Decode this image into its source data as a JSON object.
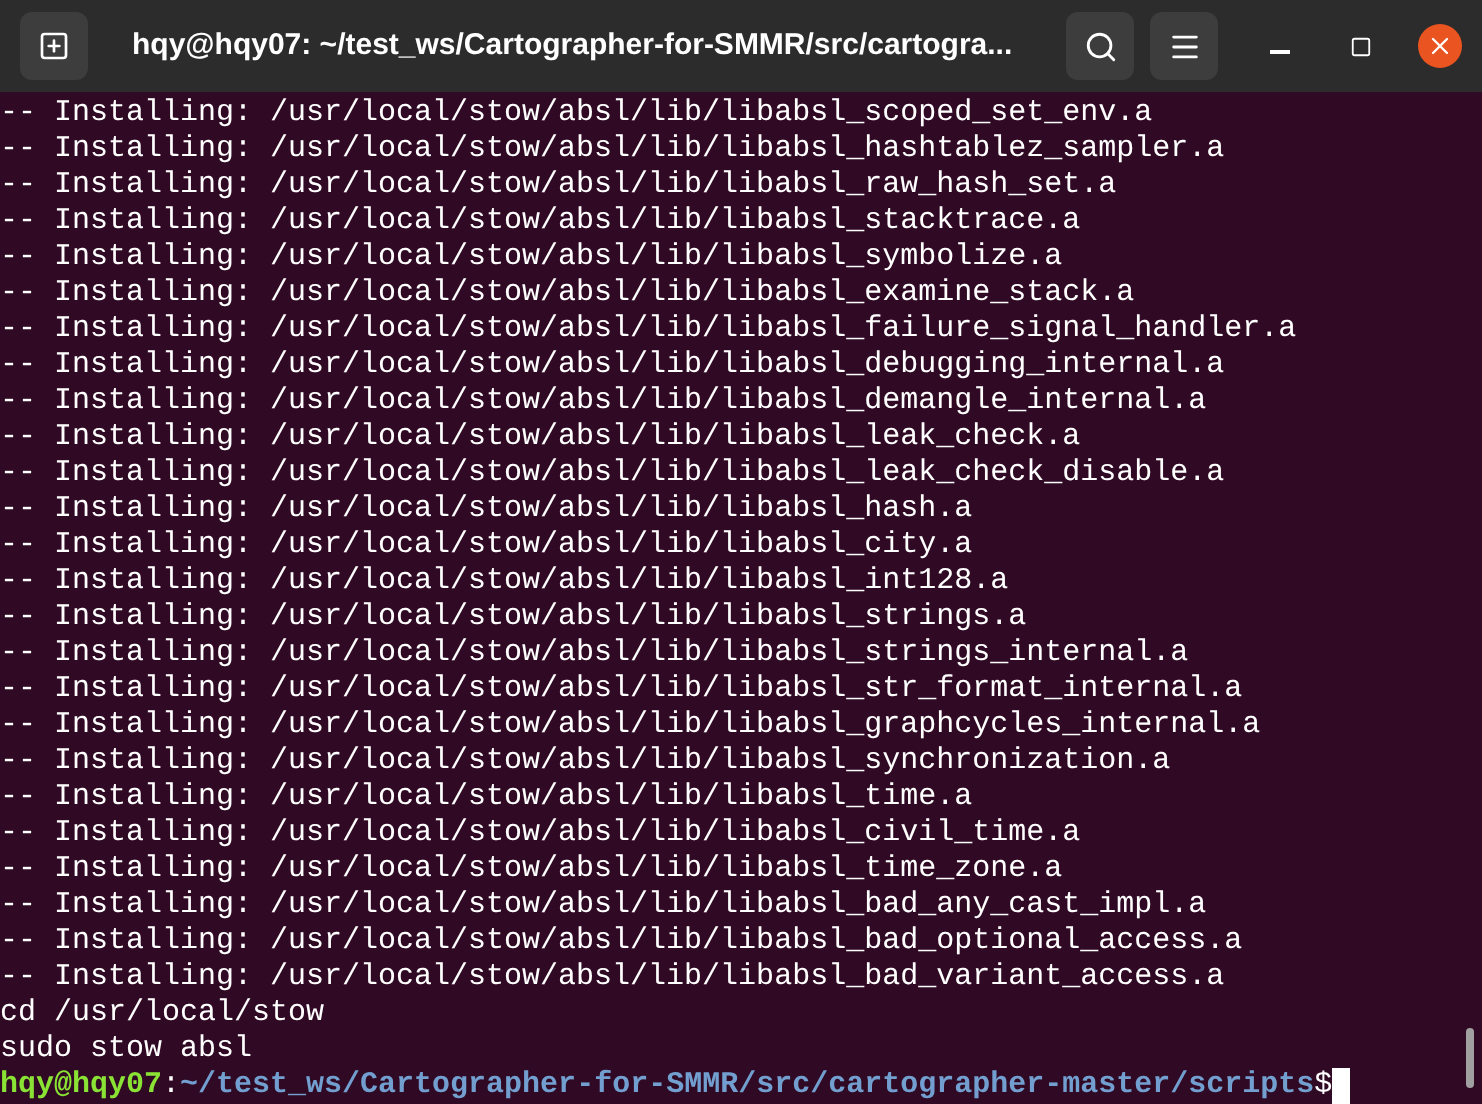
{
  "window": {
    "title": "hqy@hqy07: ~/test_ws/Cartographer-for-SMMR/src/cartogra..."
  },
  "output_lines": [
    "-- Installing: /usr/local/stow/absl/lib/libabsl_scoped_set_env.a",
    "-- Installing: /usr/local/stow/absl/lib/libabsl_hashtablez_sampler.a",
    "-- Installing: /usr/local/stow/absl/lib/libabsl_raw_hash_set.a",
    "-- Installing: /usr/local/stow/absl/lib/libabsl_stacktrace.a",
    "-- Installing: /usr/local/stow/absl/lib/libabsl_symbolize.a",
    "-- Installing: /usr/local/stow/absl/lib/libabsl_examine_stack.a",
    "-- Installing: /usr/local/stow/absl/lib/libabsl_failure_signal_handler.a",
    "-- Installing: /usr/local/stow/absl/lib/libabsl_debugging_internal.a",
    "-- Installing: /usr/local/stow/absl/lib/libabsl_demangle_internal.a",
    "-- Installing: /usr/local/stow/absl/lib/libabsl_leak_check.a",
    "-- Installing: /usr/local/stow/absl/lib/libabsl_leak_check_disable.a",
    "-- Installing: /usr/local/stow/absl/lib/libabsl_hash.a",
    "-- Installing: /usr/local/stow/absl/lib/libabsl_city.a",
    "-- Installing: /usr/local/stow/absl/lib/libabsl_int128.a",
    "-- Installing: /usr/local/stow/absl/lib/libabsl_strings.a",
    "-- Installing: /usr/local/stow/absl/lib/libabsl_strings_internal.a",
    "-- Installing: /usr/local/stow/absl/lib/libabsl_str_format_internal.a",
    "-- Installing: /usr/local/stow/absl/lib/libabsl_graphcycles_internal.a",
    "-- Installing: /usr/local/stow/absl/lib/libabsl_synchronization.a",
    "-- Installing: /usr/local/stow/absl/lib/libabsl_time.a",
    "-- Installing: /usr/local/stow/absl/lib/libabsl_civil_time.a",
    "-- Installing: /usr/local/stow/absl/lib/libabsl_time_zone.a",
    "-- Installing: /usr/local/stow/absl/lib/libabsl_bad_any_cast_impl.a",
    "-- Installing: /usr/local/stow/absl/lib/libabsl_bad_optional_access.a",
    "-- Installing: /usr/local/stow/absl/lib/libabsl_bad_variant_access.a",
    "cd /usr/local/stow",
    "sudo stow absl"
  ],
  "prompt": {
    "user_host": "hqy@hqy07",
    "separator": ":",
    "path": "~/test_ws/Cartographer-for-SMMR/src/cartographer-master/scripts",
    "symbol": "$"
  }
}
